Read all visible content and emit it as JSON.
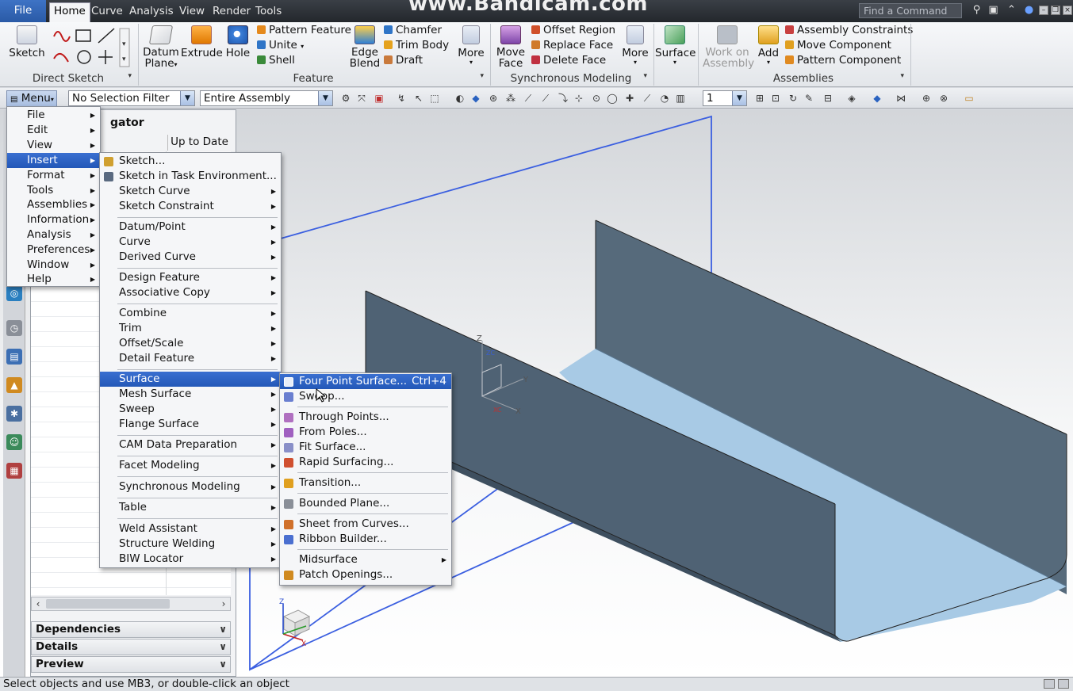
{
  "watermark": "www.Bandicam.com",
  "tabs": {
    "file": "File",
    "home": "Home",
    "curve": "Curve",
    "analysis": "Analysis",
    "view": "View",
    "render": "Render",
    "tools": "Tools"
  },
  "find_command": {
    "placeholder": "Find a Command"
  },
  "ribbon": {
    "direct_sketch": {
      "sketch": "Sketch",
      "group_label": "Direct Sketch"
    },
    "feature": {
      "datum_plane_line1": "Datum",
      "datum_plane_line2": "Plane",
      "extrude": "Extrude",
      "hole": "Hole",
      "pattern_feature": "Pattern Feature",
      "unite": "Unite",
      "shell": "Shell",
      "edge_blend_line1": "Edge",
      "edge_blend_line2": "Blend",
      "chamfer": "Chamfer",
      "trim_body": "Trim Body",
      "draft": "Draft",
      "more": "More",
      "group_label": "Feature"
    },
    "synchronous": {
      "move_face_line1": "Move",
      "move_face_line2": "Face",
      "offset_region": "Offset Region",
      "replace_face": "Replace Face",
      "delete_face": "Delete Face",
      "more": "More",
      "group_label": "Synchronous Modeling"
    },
    "surface": {
      "surface": "Surface"
    },
    "assemblies": {
      "work_on_line1": "Work on",
      "work_on_line2": "Assembly",
      "add": "Add",
      "assembly_constraints": "Assembly Constraints",
      "move_component": "Move Component",
      "pattern_component": "Pattern Component",
      "group_label": "Assemblies"
    }
  },
  "selection_bar": {
    "menu": "Menu",
    "filter": "No Selection Filter",
    "scope": "Entire Assembly",
    "layer": "1"
  },
  "navigator": {
    "title": "gator",
    "column": "Up to Date",
    "sections": [
      "Dependencies",
      "Details",
      "Preview"
    ]
  },
  "main_menu": {
    "items": [
      "File",
      "Edit",
      "View",
      "Insert",
      "Format",
      "Tools",
      "Assemblies",
      "Information",
      "Analysis",
      "Preferences",
      "Window",
      "Help"
    ],
    "highlighted": "Insert"
  },
  "insert_menu": {
    "items": [
      "Sketch...",
      "Sketch in Task Environment...",
      "Sketch Curve",
      "Sketch Constraint",
      "Datum/Point",
      "Curve",
      "Derived Curve",
      "Design Feature",
      "Associative Copy",
      "Combine",
      "Trim",
      "Offset/Scale",
      "Detail Feature",
      "Surface",
      "Mesh Surface",
      "Sweep",
      "Flange Surface",
      "CAM Data Preparation",
      "Facet Modeling",
      "Synchronous Modeling",
      "Table",
      "Weld Assistant",
      "Structure Welding",
      "BIW Locator"
    ],
    "highlighted": "Surface"
  },
  "surface_menu": {
    "items": [
      "Four Point Surface...",
      "Swoop...",
      "Through Points...",
      "From Poles...",
      "Fit Surface...",
      "Rapid Surfacing...",
      "Transition...",
      "Bounded Plane...",
      "Sheet from Curves...",
      "Ribbon Builder...",
      "Midsurface",
      "Patch Openings..."
    ],
    "shortcut": "Ctrl+4",
    "highlighted": "Four Point Surface..."
  },
  "csys_labels": {
    "z": "Z",
    "y": "Y",
    "x": "X",
    "zc": "ZC",
    "xc": "XC"
  },
  "status": "Select objects and use MB3, or double-click an object",
  "colors": {
    "menu_highlight": "#2f64c4",
    "part_dark": "#516475",
    "part_light": "#a6c8e3",
    "datum_plane": "#3b5fe0"
  }
}
